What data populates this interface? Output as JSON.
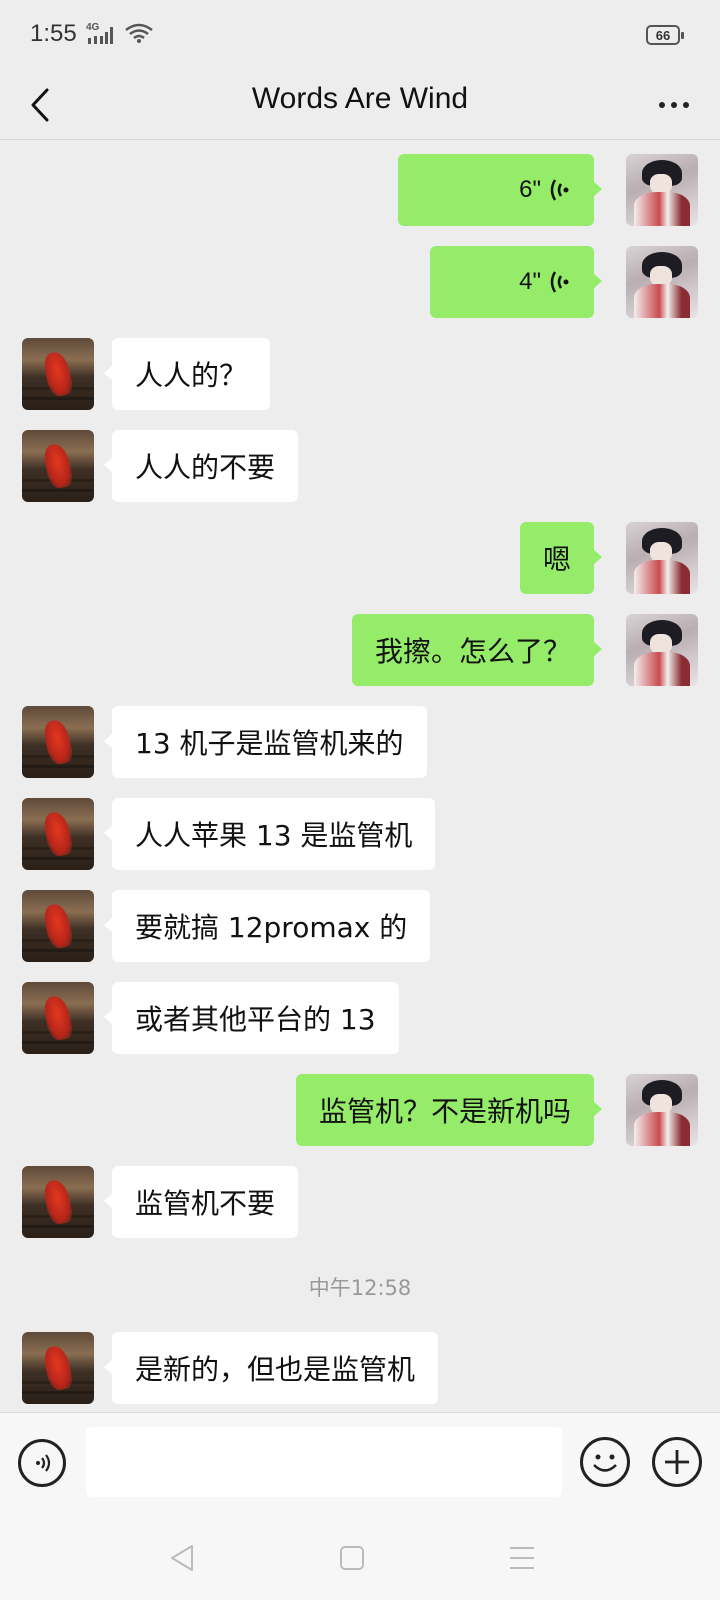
{
  "status": {
    "time": "1:55",
    "network": "4G",
    "battery": "66"
  },
  "header": {
    "title": "Words Are Wind"
  },
  "messages": [
    {
      "side": "out",
      "kind": "voice",
      "duration": "6\""
    },
    {
      "side": "out",
      "kind": "voice",
      "duration": "4\""
    },
    {
      "side": "in",
      "kind": "text",
      "text": "人人的？"
    },
    {
      "side": "in",
      "kind": "text",
      "text": "人人的不要"
    },
    {
      "side": "out",
      "kind": "text",
      "text": "嗯"
    },
    {
      "side": "out",
      "kind": "text",
      "text": "我擦。怎么了？"
    },
    {
      "side": "in",
      "kind": "text",
      "text": "13 机子是监管机来的"
    },
    {
      "side": "in",
      "kind": "text",
      "text": "人人苹果 13 是监管机"
    },
    {
      "side": "in",
      "kind": "text",
      "text": "要就搞 12promax 的"
    },
    {
      "side": "in",
      "kind": "text",
      "text": "或者其他平台的 13"
    },
    {
      "side": "out",
      "kind": "text",
      "text": "监管机？不是新机吗"
    },
    {
      "side": "in",
      "kind": "text",
      "text": "监管机不要"
    },
    {
      "side": "in",
      "kind": "text",
      "text": "是新的，但也是监管机"
    }
  ],
  "time_separator": "中午12:58",
  "input": {
    "value": "",
    "placeholder": ""
  }
}
